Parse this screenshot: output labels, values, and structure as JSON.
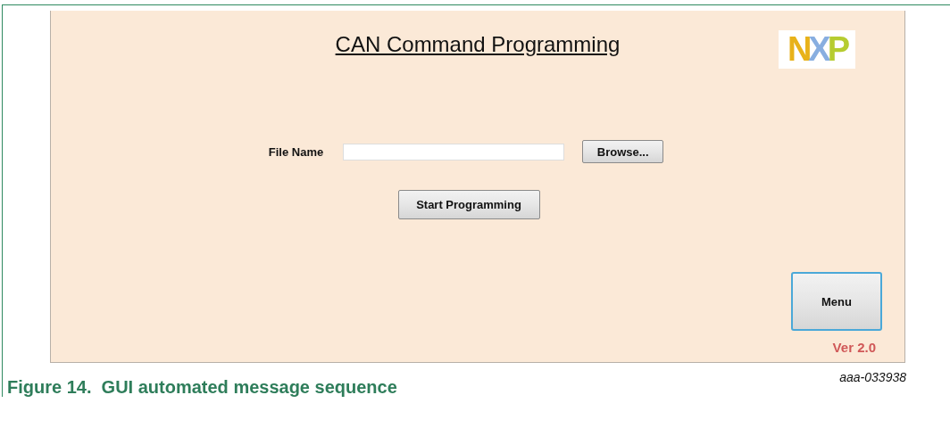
{
  "window": {
    "title": "CAN Command Programming",
    "logo": "NXP"
  },
  "file_field": {
    "label": "File Name",
    "browse_button": "Browse..."
  },
  "start_button": "Start Programming",
  "menu_button": "Menu",
  "version": "Ver 2.0",
  "figure_id": "aaa-033938",
  "caption": "Figure 14.  GUI automated message sequence"
}
